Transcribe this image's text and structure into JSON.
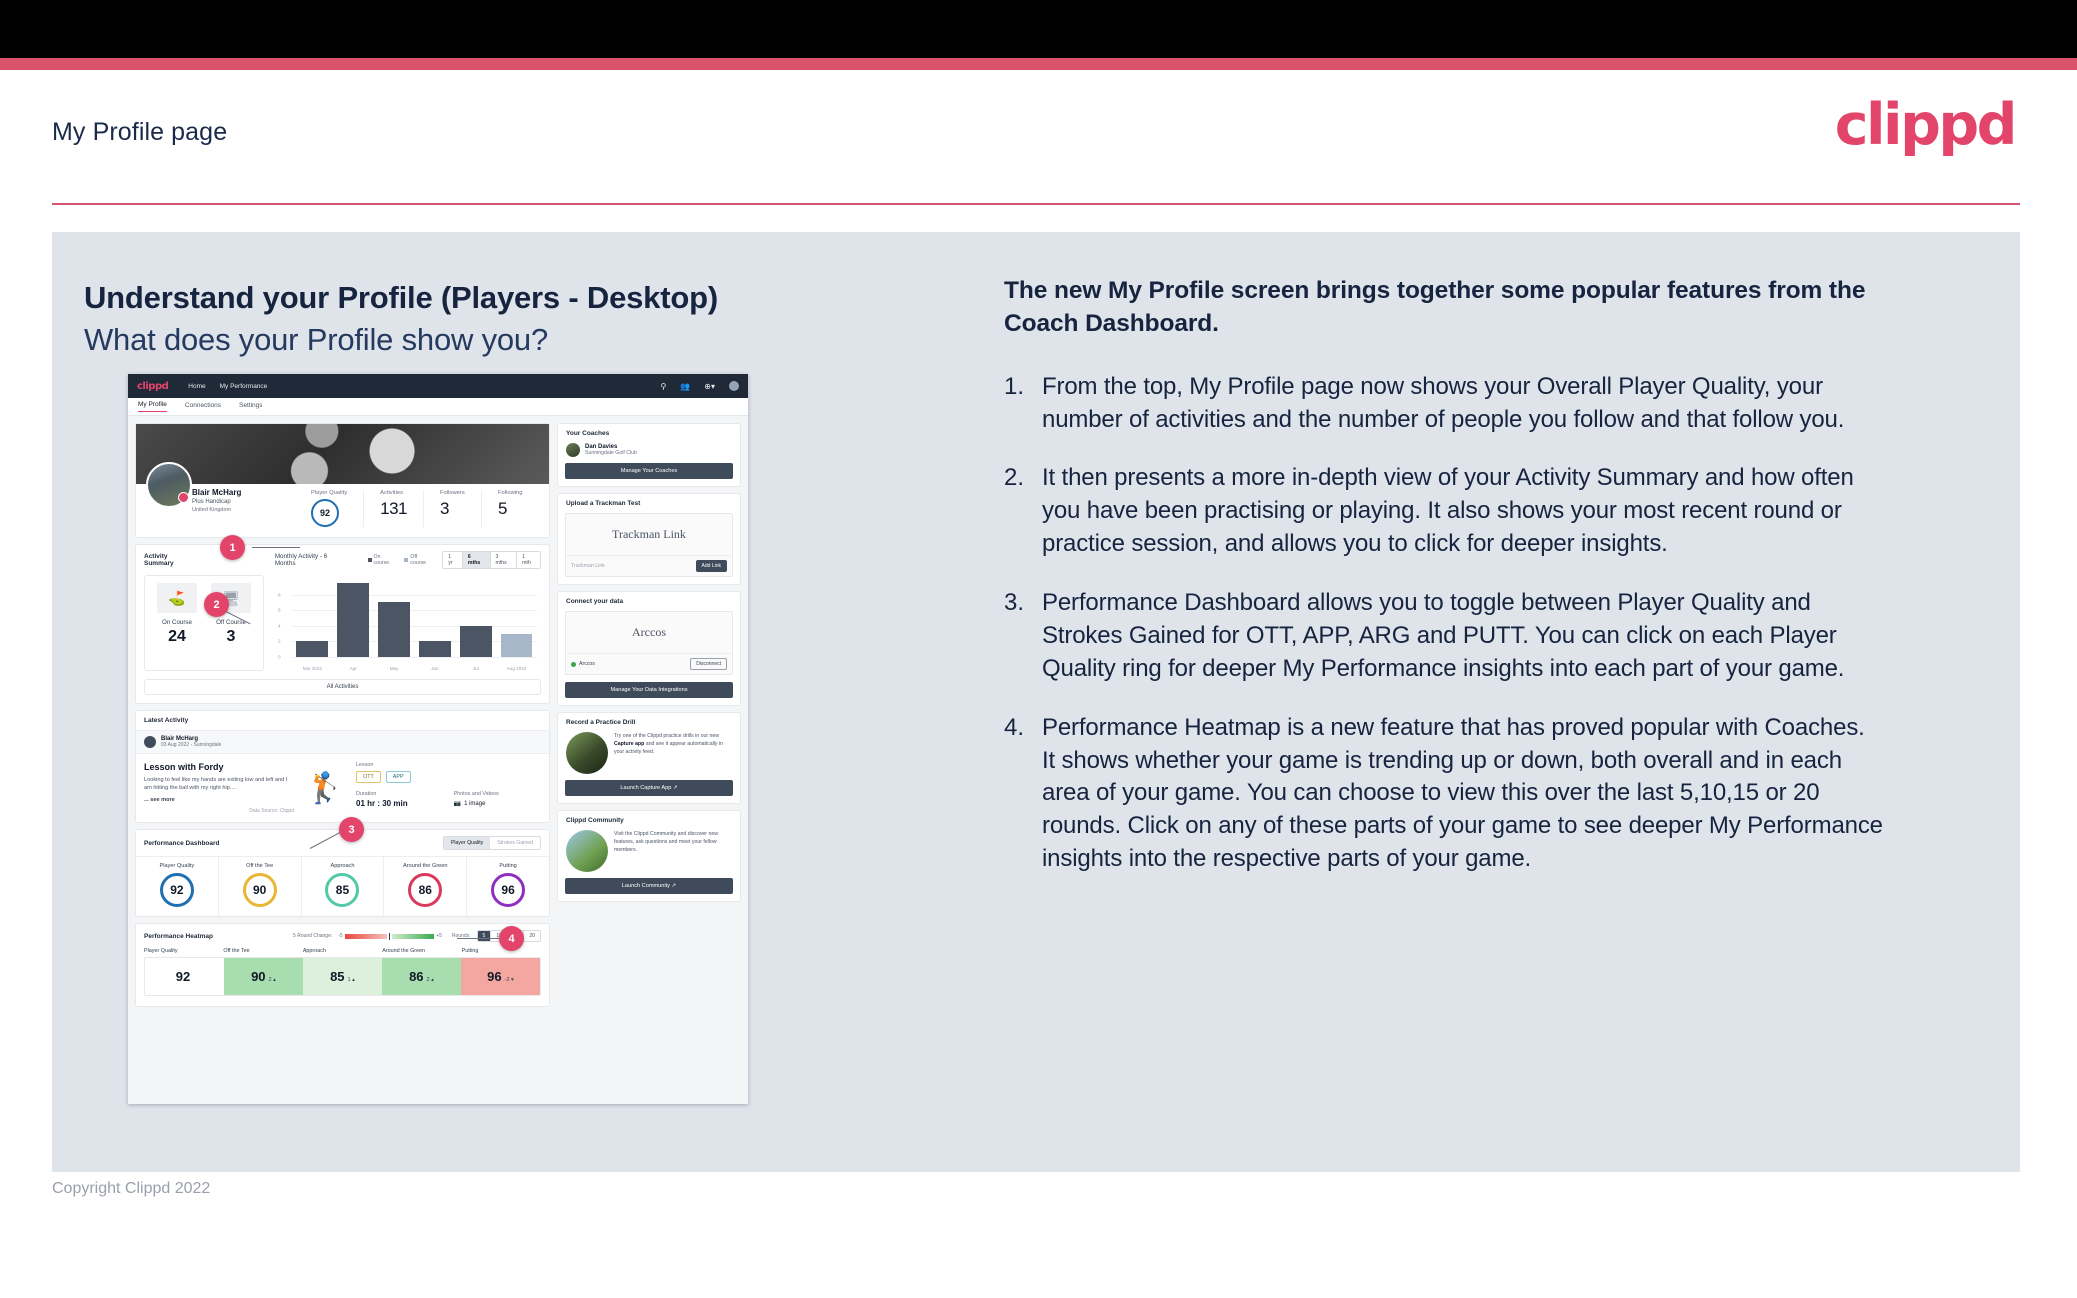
{
  "page": {
    "title": "My Profile page",
    "logo": "clippd",
    "copyright": "Copyright Clippd 2022",
    "accent": "#d9536c",
    "navy": "#16243f",
    "panel_bg": "#dfe3ea"
  },
  "slide": {
    "headline": "Understand your Profile (Players - Desktop)",
    "subheadline": "What does your Profile show you?",
    "lead": "The new My Profile screen brings together some popular features from the Coach Dashboard.",
    "items": [
      {
        "num": "1.",
        "text": "From the top, My Profile page now shows your Overall Player Quality, your number of activities and the number of people you follow and that follow you."
      },
      {
        "num": "2.",
        "text": "It then presents a more in-depth view of your Activity Summary and how often you have been practising or playing. It also shows your most recent round or practice session, and allows you to click for deeper insights."
      },
      {
        "num": "3.",
        "text": "Performance Dashboard allows you to toggle between Player Quality and Strokes Gained for OTT, APP, ARG and PUTT. You can click on each Player Quality ring for deeper My Performance insights into each part of your game."
      },
      {
        "num": "4.",
        "text": "Performance Heatmap is a new feature that has proved popular with Coaches. It shows whether your game is trending up or down, both overall and in each area of your game. You can choose to view this over the last 5,10,15 or 20 rounds. Click on any of these parts of your game to see deeper My Performance insights into the respective parts of your game."
      }
    ],
    "callouts": [
      "1",
      "2",
      "3",
      "4"
    ]
  },
  "app": {
    "logo": "clippd",
    "nav_links": [
      "Home",
      "My Performance"
    ],
    "nav_icons": [
      "search-icon",
      "people-icon",
      "add-circle-icon",
      "avatar-icon"
    ],
    "tabs": [
      {
        "label": "My Profile",
        "active": true
      },
      {
        "label": "Connections",
        "active": false
      },
      {
        "label": "Settings",
        "active": false
      }
    ],
    "profile": {
      "name": "Blair McHarg",
      "handicap": "Plus Handicap",
      "location": "United Kingdom",
      "stats": [
        {
          "label": "Player Quality",
          "value": "92",
          "type": "ring",
          "color": "#1f6fb2"
        },
        {
          "label": "Activities",
          "value": "131",
          "type": "number"
        },
        {
          "label": "Followers",
          "value": "3",
          "type": "number"
        },
        {
          "label": "Following",
          "value": "5",
          "type": "number"
        }
      ]
    },
    "activity_summary": {
      "title": "Activity Summary",
      "chart_title": "Monthly Activity - 6 Months",
      "legend": [
        {
          "label": "On course",
          "color": "#4b5563"
        },
        {
          "label": "Off course",
          "color": "#a8b6c9"
        }
      ],
      "range_options": [
        "1 yr",
        "6 mths",
        "3 mths",
        "1 mth"
      ],
      "range_selected": "6 mths",
      "on_course_label": "On Course",
      "on_course_value": "24",
      "off_course_label": "Off Course",
      "off_course_value": "3",
      "all_activities": "All Activities"
    },
    "latest_activity": {
      "section_title": "Latest Activity",
      "user": "Blair McHarg",
      "meta": "03 Aug 2022 - Sunningdale",
      "title": "Lesson with Fordy",
      "body": "Looking to feel like my hands are exiting low and left and I am hitting the ball with my right hip....",
      "see_more": "... see more",
      "source": "Data Source: Clippd",
      "lesson_label": "Lesson",
      "tags": [
        "OTT",
        "APP"
      ],
      "duration_label": "Duration",
      "duration_value": "01 hr : 30 min",
      "photos_label": "Photos and Videos",
      "photos_value": "1 image"
    },
    "performance_dashboard": {
      "title": "Performance Dashboard",
      "toggle": [
        "Player Quality",
        "Strokes Gained"
      ],
      "toggle_selected": "Player Quality",
      "rings": [
        {
          "label": "Player Quality",
          "value": "92",
          "color": "#1f6fb2"
        },
        {
          "label": "Off the Tee",
          "value": "90",
          "color": "#e8b633"
        },
        {
          "label": "Approach",
          "value": "85",
          "color": "#52c9a8"
        },
        {
          "label": "Around the Green",
          "value": "86",
          "color": "#d93a5c"
        },
        {
          "label": "Putting",
          "value": "96",
          "color": "#8e2fc0"
        }
      ]
    },
    "performance_heatmap": {
      "title": "Performance Heatmap",
      "scale_label": "5 Round Change:",
      "scale_min": "-5",
      "scale_max": "+5",
      "rounds_label": "Rounds:",
      "rounds_options": [
        "5",
        "10",
        "15",
        "20"
      ],
      "rounds_selected": "5",
      "cells": [
        {
          "label": "Player Quality",
          "value": "92",
          "delta": "",
          "bg": "#ffffff"
        },
        {
          "label": "Off the Tee",
          "value": "90",
          "delta": "2 ▴",
          "bg": "#a8ddb0"
        },
        {
          "label": "Approach",
          "value": "85",
          "delta": "1 ▴",
          "bg": "#dcf0dc"
        },
        {
          "label": "Around the Green",
          "value": "86",
          "delta": "2 ▴",
          "bg": "#a8ddb0"
        },
        {
          "label": "Putting",
          "value": "96",
          "delta": "-2 ▾",
          "bg": "#f4a6a0"
        }
      ]
    },
    "sidebar": {
      "coaches": {
        "title": "Your Coaches",
        "coach_name": "Dan Davies",
        "coach_club": "Sunningdale Golf Club",
        "button": "Manage Your Coaches"
      },
      "trackman": {
        "title": "Upload a Trackman Test",
        "brand": "Trackman Link",
        "placeholder": "Trackman Link",
        "button": "Add Link"
      },
      "connect": {
        "title": "Connect your data",
        "brand": "Arccos",
        "status_name": "Arccos",
        "status_button": "Disconnect",
        "button": "Manage Your Data Integrations"
      },
      "practice": {
        "title": "Record a Practice Drill",
        "body_1": "Try one of the Clippd practice drills in our new ",
        "body_bold": "Capture app",
        "body_2": " and see it appear automatically in your activity feed.",
        "button": "Launch Capture App"
      },
      "community": {
        "title": "Clippd Community",
        "body": "Visit the Clippd Community and discover new features, ask questions and meet your fellow members.",
        "button": "Launch Community"
      }
    }
  },
  "chart_data": {
    "type": "bar",
    "title": "Monthly Activity - 6 Months",
    "categories": [
      "Mar 2022",
      "Apr",
      "May",
      "Jun",
      "Jul",
      "Aug 2022"
    ],
    "values": [
      2,
      9.5,
      7,
      2,
      4,
      3
    ],
    "bar_colors": [
      "#4b5563",
      "#4b5563",
      "#4b5563",
      "#4b5563",
      "#4b5563",
      "#a8b6c9"
    ],
    "series": [
      {
        "name": "On course",
        "values": [
          2,
          9.5,
          7,
          2,
          4,
          0
        ],
        "color": "#4b5563"
      },
      {
        "name": "Off course",
        "values": [
          0,
          0,
          0,
          0,
          0,
          3
        ],
        "color": "#a8b6c9"
      }
    ],
    "yticks": [
      0,
      2,
      4,
      6,
      8
    ],
    "ylim": [
      0,
      10
    ],
    "xlabel": "",
    "ylabel": "",
    "grid": true,
    "legend_position": "top"
  }
}
